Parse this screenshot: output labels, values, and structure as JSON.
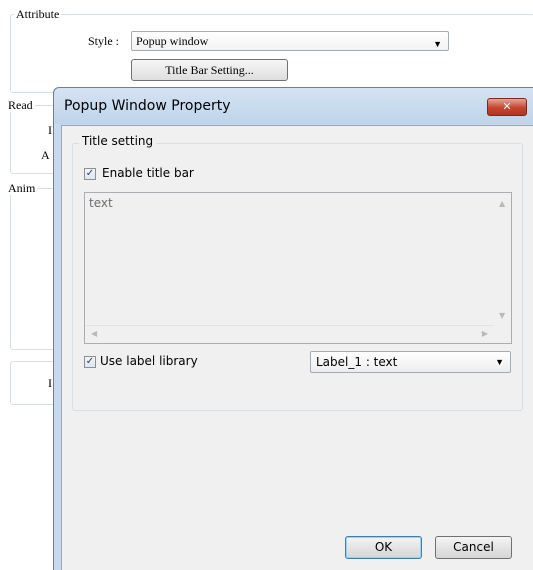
{
  "background_dialog": {
    "attribute_group": {
      "legend": "Attribute",
      "style_label": "Style :",
      "style_value": "Popup window",
      "title_bar_button": "Title Bar Setting..."
    },
    "read_group": {
      "legend": "Read",
      "fragment_1": "I",
      "fragment_2": "A"
    },
    "anim_group": {
      "legend": "Anim"
    },
    "lower_group": {
      "fragment": "I"
    }
  },
  "popup": {
    "title": "Popup Window Property",
    "close_glyph": "✕",
    "title_setting": {
      "legend": "Title setting",
      "enable_title_bar": {
        "label": "Enable title bar",
        "checked": true
      },
      "text_area": {
        "value": "text"
      },
      "use_label_library": {
        "label": "Use label library",
        "checked": true
      },
      "label_select": {
        "value": "Label_1 : text"
      }
    },
    "buttons": {
      "ok": "OK",
      "cancel": "Cancel"
    }
  },
  "icons": {
    "checkbox_checked": "✓",
    "dropdown_arrow": "▼",
    "scroll_up": "▲",
    "scroll_down": "▼",
    "scroll_left": "◀",
    "scroll_right": "▶"
  },
  "colors": {
    "titlebar": "#c6d9ee",
    "close_button": "#c7432f",
    "client_background": "#f0f0f0"
  }
}
